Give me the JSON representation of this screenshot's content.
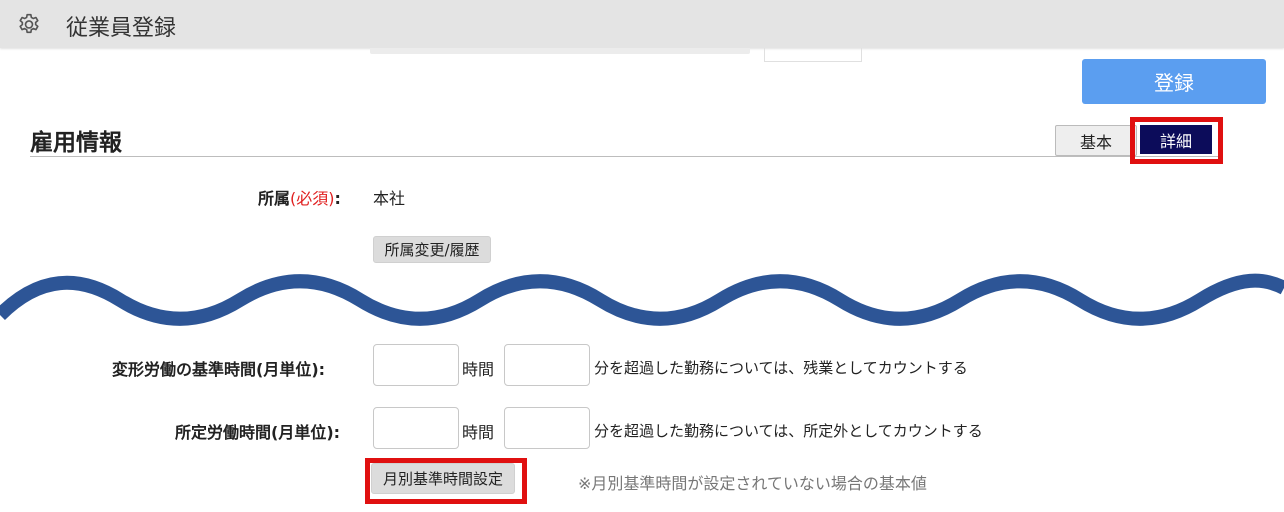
{
  "header": {
    "title": "従業員登録",
    "icon": "gear-icon"
  },
  "toolbar": {
    "register_label": "登録"
  },
  "section": {
    "title": "雇用情報"
  },
  "tabs": [
    {
      "label": "基本",
      "active": false
    },
    {
      "label": "詳細",
      "active": true
    }
  ],
  "affiliation": {
    "label": "所属",
    "required": "(必須)",
    "colon": ":",
    "value": "本社",
    "change_button": "所属変更/履歴"
  },
  "variable_labor": {
    "label": "変形労働の基準時間(月単位):",
    "hours_value": "",
    "hours_unit": "時間",
    "minutes_value": "",
    "description": "分を超過した勤務については、残業としてカウントする"
  },
  "scheduled_labor": {
    "label": "所定労働時間(月単位):",
    "hours_value": "",
    "hours_unit": "時間",
    "minutes_value": "",
    "description": "分を超過した勤務については、所定外としてカウントする"
  },
  "monthly": {
    "button": "月別基準時間設定",
    "note": "※月別基準時間が設定されていない場合の基本値"
  },
  "colors": {
    "register_button": "#5b9ef0",
    "active_tab": "#0c0c5a",
    "highlight": "#e01010",
    "wave": "#2d5596",
    "required": "#e02020"
  }
}
